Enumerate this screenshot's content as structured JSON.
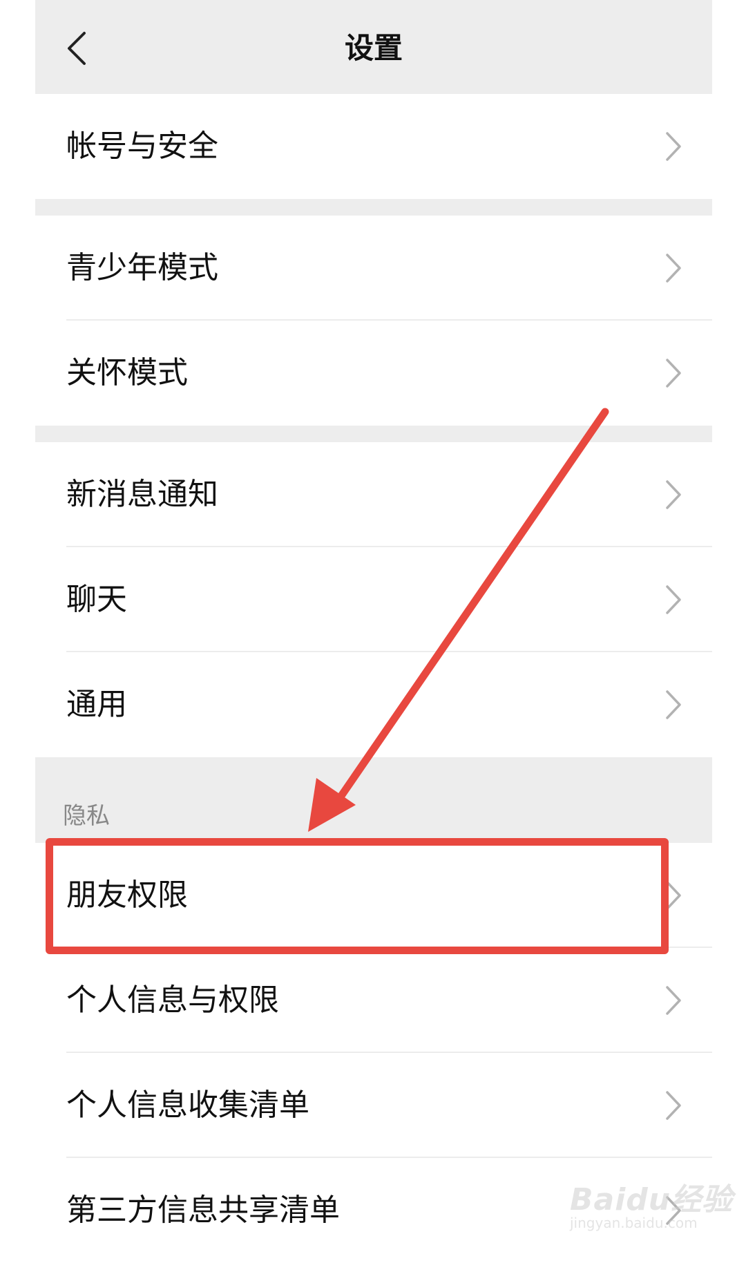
{
  "header": {
    "title": "设置",
    "back_icon": "chevron-left-icon"
  },
  "groups": [
    {
      "items": [
        {
          "label": "帐号与安全"
        }
      ]
    },
    {
      "items": [
        {
          "label": "青少年模式"
        },
        {
          "label": "关怀模式"
        }
      ]
    },
    {
      "items": [
        {
          "label": "新消息通知"
        },
        {
          "label": "聊天"
        },
        {
          "label": "通用"
        }
      ]
    },
    {
      "section_label": "隐私",
      "items": [
        {
          "label": "朋友权限"
        },
        {
          "label": "个人信息与权限"
        },
        {
          "label": "个人信息收集清单"
        },
        {
          "label": "第三方信息共享清单"
        }
      ]
    }
  ],
  "annotation": {
    "color": "#e8483f"
  },
  "watermark": {
    "brand": "Baidu经验",
    "url": "jingyan.baidu.com"
  },
  "colors": {
    "background": "#ededed",
    "row": "#ffffff",
    "chevron": "#b2b2b2"
  }
}
